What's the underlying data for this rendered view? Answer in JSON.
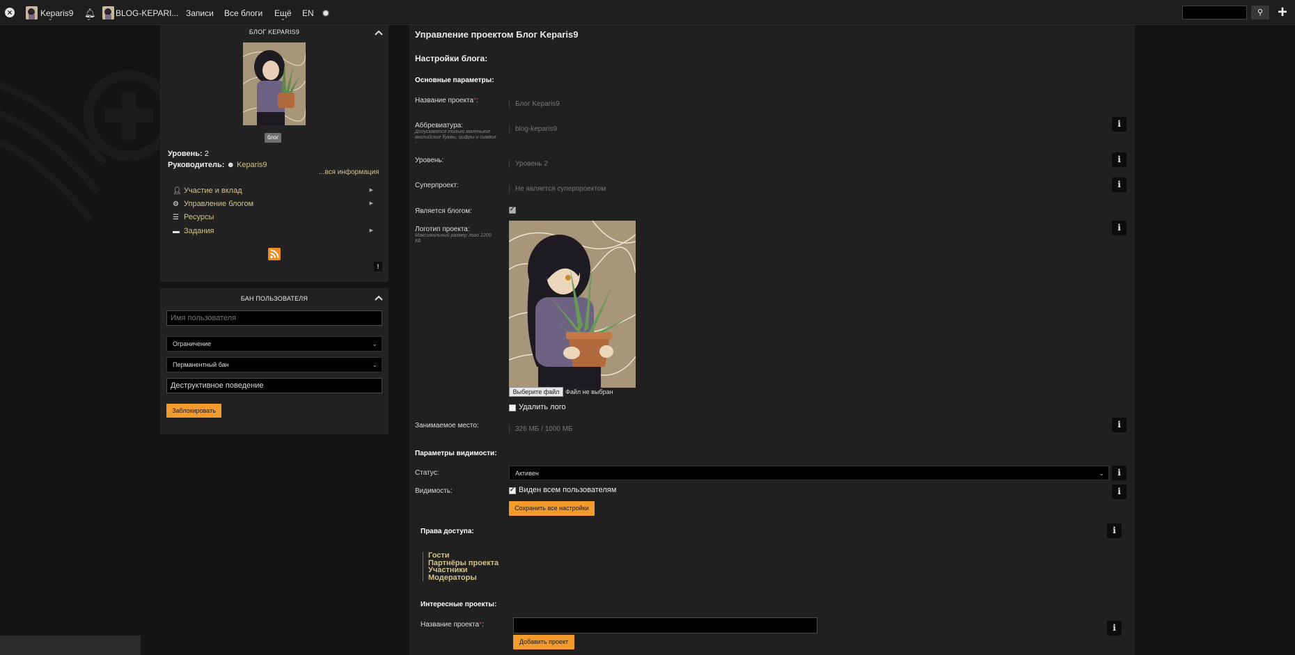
{
  "topbar": {
    "user": "Keparis9",
    "blog": "BLOG-KEPARI...",
    "nav_posts": "Записи",
    "nav_all_blogs": "Все блоги",
    "nav_more": "Ещё",
    "lang": "EN"
  },
  "sidebar": {
    "blog_panel_title": "БЛОГ KEPARIS9",
    "blog_tag": "блог",
    "level_label": "Уровень:",
    "level_value": "2",
    "leader_label": "Руководитель:",
    "leader_name": "Keparis9",
    "all_info_link": "...вся информация",
    "menu": [
      {
        "label": "Участие и вклад",
        "icon": "user-check-icon"
      },
      {
        "label": "Управление блогом",
        "icon": "gears-icon"
      },
      {
        "label": "Ресурсы",
        "icon": "list-icon"
      },
      {
        "label": "Задания",
        "icon": "tasks-icon"
      }
    ],
    "ban_panel_title": "БАН ПОЛЬЗОВАТЕЛЯ",
    "username_placeholder": "Имя пользователя",
    "restriction_select": "Ограничение",
    "ban_type_select": "Перманентный бан",
    "reason_value": "Деструктивное поведение",
    "block_button": "Заблокировать",
    "excl_button": "!"
  },
  "main": {
    "title": "Управление проектом Блог Keparis9",
    "blog_settings_heading": "Настройки блога:",
    "basic_params_heading": "Основные параметры:",
    "project_name_label": "Название проекта",
    "project_name_value": "Блог Keparis9",
    "abbr_label": "Аббревиатура:",
    "abbr_hint": "Допускаются только маленькие английские буквы, цифры и символ -",
    "abbr_value": "blog-keparis9",
    "level_label": "Уровень:",
    "level_value": "Уровень 2",
    "superproject_label": "Суперпроект:",
    "superproject_value": "Не является суперпроектом",
    "is_blog_label": "Является блогом:",
    "logo_label": "Логотип проекта:",
    "logo_hint": "Максимальный размер лого 1200 КБ",
    "file_button": "Выберите файл",
    "file_status": "Файл не выбран",
    "delete_logo_label": "Удалить лого",
    "storage_label": "Занимаемое место:",
    "storage_value": "326 МБ / 1000 МБ",
    "visibility_heading": "Параметры видимости:",
    "status_label": "Статус:",
    "status_value": "Активен",
    "visibility_label": "Видимость:",
    "visibility_option": "Виден всем пользователям",
    "save_button": "Сохранить все настройки",
    "access_heading": "Права доступа:",
    "access_list": [
      "Гости",
      "Партнёры проекта",
      "Участники",
      "Модераторы"
    ],
    "interesting_heading": "Интересные проекты:",
    "project_name_label2": "Название проекта",
    "add_project_button": "Добавить проект",
    "info_btn": "i"
  }
}
